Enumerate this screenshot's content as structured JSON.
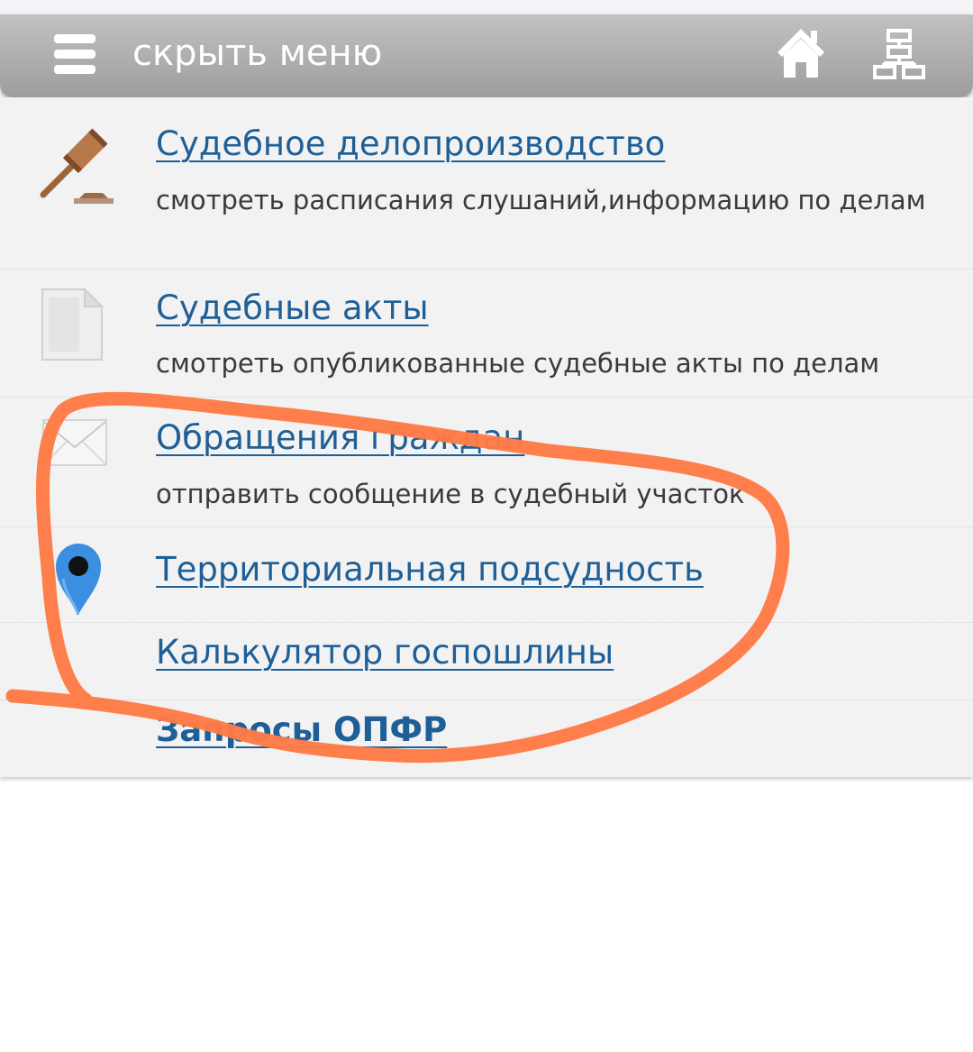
{
  "header": {
    "toggle_label": "скрыть меню",
    "menu_icon": "hamburger-menu-icon",
    "home_icon": "home-icon",
    "sitemap_icon": "sitemap-icon"
  },
  "menu": {
    "items": [
      {
        "title": "Судебное делопроизводство",
        "description": "смотреть расписания слушаний,информацию по делам",
        "icon": "gavel-icon"
      },
      {
        "title": "Судебные акты",
        "description": "смотреть опубликованные судебные акты по делам",
        "icon": "document-icon"
      },
      {
        "title": "Обращения граждан",
        "description": "отправить сообщение в судебный участок",
        "icon": "envelope-icon"
      },
      {
        "title": "Территориальная подсудность",
        "icon": "map-pin-icon"
      },
      {
        "title": "Калькулятор госпошлины"
      },
      {
        "title": "Запросы ОПФР"
      }
    ]
  },
  "colors": {
    "link": "#1f5f97",
    "header_bar": "#a8a8a8",
    "panel_bg": "#f2f2f2",
    "annotation_stroke": "#ff7a45"
  }
}
